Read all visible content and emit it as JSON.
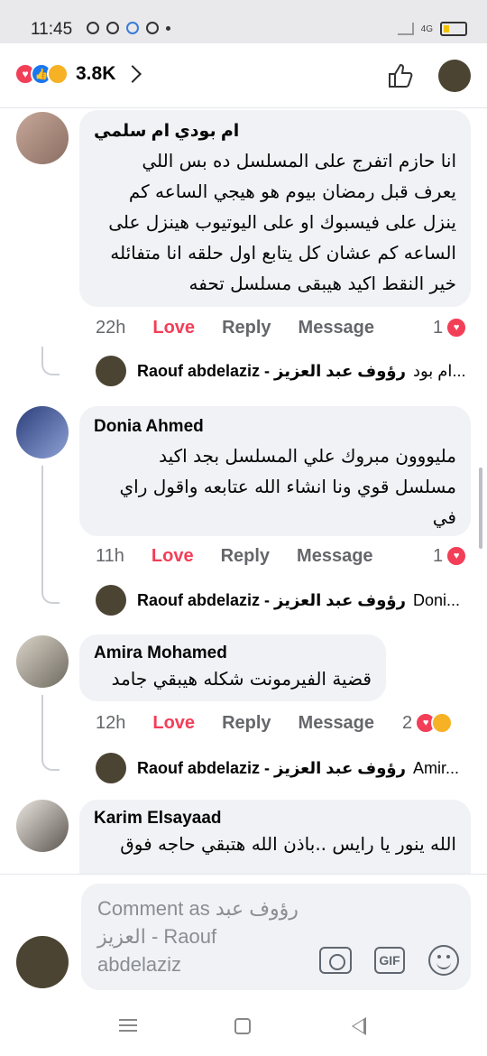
{
  "status_bar": {
    "time": "11:45",
    "battery": "14"
  },
  "header": {
    "reaction_count": "3.8K"
  },
  "comments": [
    {
      "author": "ام بودي ام سلمي",
      "text": "انا حازم اتفرج على المسلسل ده بس اللي يعرف قبل رمضان بيوم هو هيجي الساعه كم ينزل على فيسبوك او على اليوتيوب هينزل على الساعه كم عشان كل يتابع اول حلقه انا متفائله خير النقط اكيد هيبقى مسلسل تحفه",
      "time": "22h",
      "love": "Love",
      "reply": "Reply",
      "message": "Message",
      "reactions": "1",
      "reply_preview": {
        "name": "Raouf abdelaziz - رؤوف عبد العزيز",
        "snippet": "ام بود..."
      }
    },
    {
      "author": "Donia Ahmed",
      "text": "مليووون مبروك علي المسلسل  بجد اكيد مسلسل قوي ونا انشاء الله عتابعه واقول راي في",
      "time": "11h",
      "love": "Love",
      "reply": "Reply",
      "message": "Message",
      "reactions": "1",
      "reply_preview": {
        "name": "Raouf abdelaziz - رؤوف عبد العزيز",
        "snippet": "Doni..."
      }
    },
    {
      "author": "Amira Mohamed",
      "text": "قضية الفيرمونت شكله هيبقي جامد",
      "time": "12h",
      "love": "Love",
      "reply": "Reply",
      "message": "Message",
      "reactions": "2",
      "reply_preview": {
        "name": "Raouf abdelaziz - رؤوف عبد العزيز",
        "snippet": "Amir..."
      }
    },
    {
      "author": "Karim Elsayaad",
      "text": "الله ينور يا رايس ..باذن الله هتبقي حاجه فوق"
    }
  ],
  "composer": {
    "placeholder": "Comment as رؤوف عبد العزيز - Raouf abdelaziz"
  },
  "colors": {
    "love": "#f33e58",
    "like": "#1877f2",
    "care": "#f7b125",
    "bubble": "#f0f2f5"
  },
  "icons": [
    "love-icon",
    "like-icon",
    "care-icon",
    "thumbs-up-icon",
    "camera-icon",
    "gif-icon",
    "emoji-icon"
  ]
}
